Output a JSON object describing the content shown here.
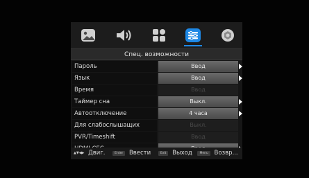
{
  "colors": {
    "accent": "#1e88e5",
    "arrow": "#ffffff"
  },
  "tabs": [
    {
      "icon": "picture-icon"
    },
    {
      "icon": "speaker-icon"
    },
    {
      "icon": "apps-icon"
    },
    {
      "icon": "accessibility-icon",
      "active": true
    },
    {
      "icon": "gear-icon"
    }
  ],
  "menu": {
    "title": "Спец. возможности",
    "rows": [
      {
        "label": "Пароль",
        "value": "Ввод",
        "enabled": true,
        "arrow": true
      },
      {
        "label": "Язык",
        "value": "Ввод",
        "enabled": true,
        "arrow": true
      },
      {
        "label": "Время",
        "value": "Ввод",
        "enabled": false,
        "arrow": false
      },
      {
        "label": "Таймер сна",
        "value": "Выкл.",
        "enabled": true,
        "arrow": true
      },
      {
        "label": "Автоотключение",
        "value": "4 часа",
        "enabled": true,
        "arrow": true
      },
      {
        "label": "Для слабослышащих",
        "value": "Выкл.",
        "enabled": false,
        "arrow": false
      },
      {
        "label": "PVR/Timeshift",
        "value": "Ввод",
        "enabled": false,
        "arrow": false
      },
      {
        "label": "HDMI CEC",
        "value": "Ввод",
        "enabled": true,
        "arrow": true
      }
    ]
  },
  "footer": {
    "nav_keys": "▲▼◀▶",
    "nav_label": "Двиг.",
    "enter_key": "Enter",
    "enter_label": "Ввести",
    "exit_key": "Exit",
    "exit_label": "Выход",
    "menu_key": "Menu",
    "menu_label": "Возвр..."
  }
}
